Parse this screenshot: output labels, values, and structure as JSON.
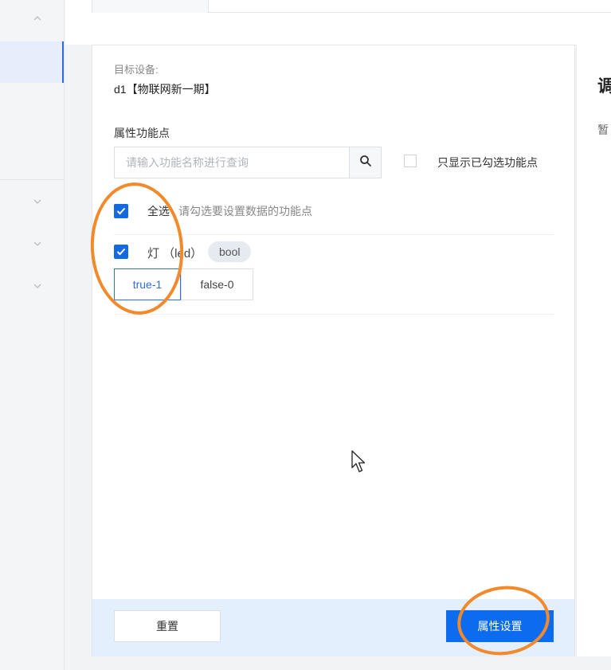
{
  "dialog": {
    "target_label": "目标设备:",
    "target_device": "d1【物联网新一期】",
    "section_title": "属性功能点",
    "search": {
      "placeholder": "请输入功能名称进行查询",
      "value": ""
    },
    "only_checked_label": "只显示已勾选功能点",
    "select_all_label": "全选",
    "select_all_hint": "请勾选要设置数据的功能点",
    "feature": {
      "name": "灯 （led）",
      "type_badge": "bool",
      "options": [
        "true-1",
        "false-0"
      ],
      "selected": "true-1"
    },
    "reset_label": "重置",
    "submit_label": "属性设置"
  },
  "right_panel": {
    "title": "调",
    "text": "暂"
  },
  "colors": {
    "accent": "#0b6cf0",
    "annotation": "#f28a2c",
    "footer_bg": "#e4effd"
  }
}
